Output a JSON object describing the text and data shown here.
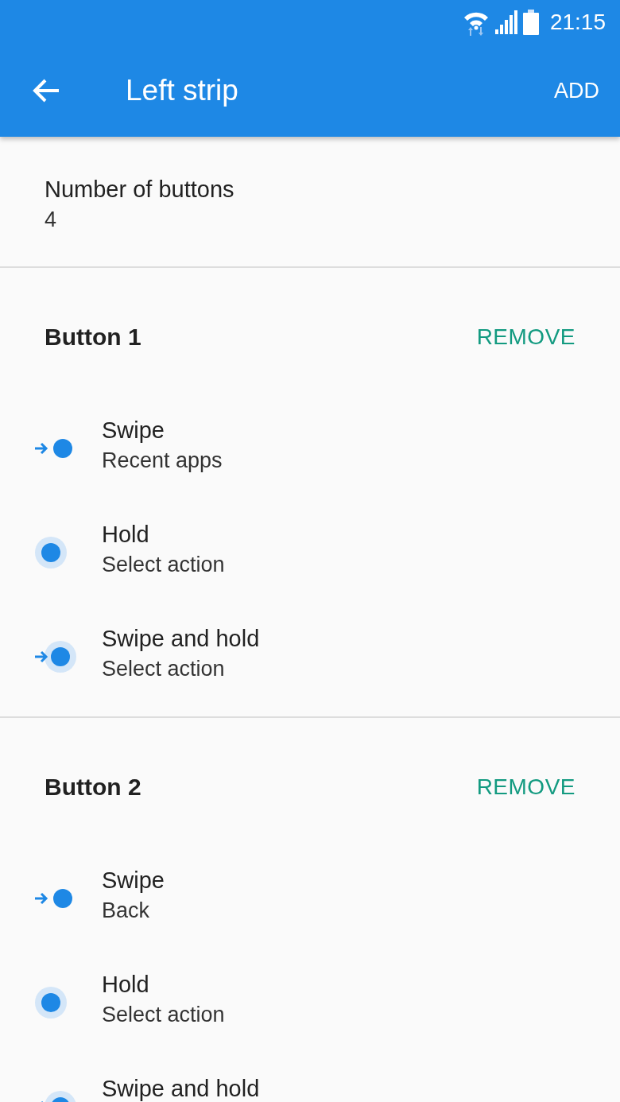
{
  "status_bar": {
    "time": "21:15"
  },
  "app_bar": {
    "title": "Left strip",
    "action": "ADD"
  },
  "setting": {
    "label": "Number of buttons",
    "value": "4"
  },
  "buttons": [
    {
      "title": "Button 1",
      "action": "REMOVE",
      "gestures": [
        {
          "kind": "swipe",
          "label": "Swipe",
          "value": "Recent apps"
        },
        {
          "kind": "hold",
          "label": "Hold",
          "value": "Select action"
        },
        {
          "kind": "swipe_hold",
          "label": "Swipe and hold",
          "value": "Select action"
        }
      ]
    },
    {
      "title": "Button 2",
      "action": "REMOVE",
      "gestures": [
        {
          "kind": "swipe",
          "label": "Swipe",
          "value": "Back"
        },
        {
          "kind": "hold",
          "label": "Hold",
          "value": "Select action"
        },
        {
          "kind": "swipe_hold",
          "label": "Swipe and hold"
        }
      ]
    }
  ]
}
